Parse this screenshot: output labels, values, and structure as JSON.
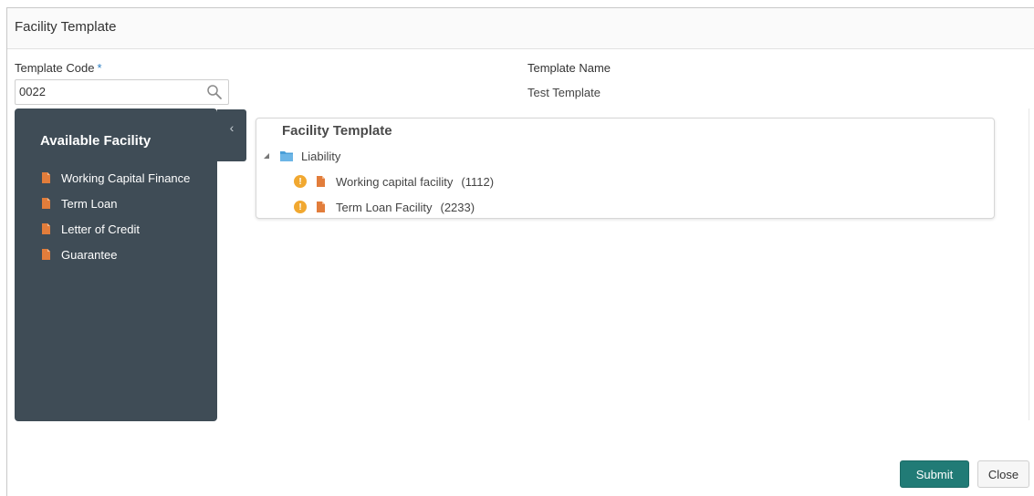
{
  "header": {
    "title": "Facility Template"
  },
  "form": {
    "template_code": {
      "label": "Template Code",
      "required_mark": "*",
      "value": "0022"
    },
    "template_name": {
      "label": "Template Name",
      "value": "Test Template"
    }
  },
  "available": {
    "title": "Available Facility",
    "items": [
      {
        "label": "Working Capital Finance"
      },
      {
        "label": "Term Loan"
      },
      {
        "label": "Letter of Credit"
      },
      {
        "label": "Guarantee"
      }
    ]
  },
  "collapse": {
    "glyph": "‹"
  },
  "tree": {
    "title": "Facility Template",
    "root": {
      "label": "Liability"
    },
    "children": [
      {
        "label": "Working capital facility",
        "count": "(1112)",
        "warning": "!"
      },
      {
        "label": "Term Loan Facility",
        "count": "(2233)",
        "warning": "!"
      }
    ]
  },
  "actions": {
    "submit": "Submit",
    "close": "Close"
  },
  "colors": {
    "panel": "#3f4c56",
    "accent": "#217b76",
    "doc_icon": "#e27d3b",
    "warning": "#f1a830",
    "folder": "#4a9fd8",
    "required": "#2b7fc4"
  },
  "icons": {
    "search": "search-icon",
    "doc": "document-icon",
    "folder": "folder-icon",
    "warning": "warning-icon",
    "expand": "expand-caret-icon"
  }
}
